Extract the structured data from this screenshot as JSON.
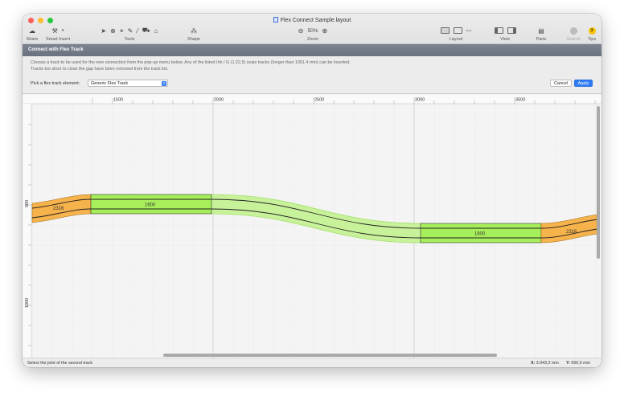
{
  "window": {
    "title": "Flex Connect Sample.layout"
  },
  "toolbar": {
    "share": "Share",
    "smart_insert": "Smart Insert",
    "tools": "Tools",
    "shape": "Shape",
    "zoom_label": "Zoom",
    "zoom_value": "50%",
    "layout": "Layout",
    "view": "View",
    "parts": "Parts",
    "search": "Search",
    "tips": "Tips",
    "tips_glyph": "?"
  },
  "dialog": {
    "title": "Connect with Flex Track",
    "description_line1": "Choose a track to be used for the new connection from the pop-up menu below. Any of the listed IIm / G (1:22,5) scale tracks (longer than 1051.4 mm) can be inserted.",
    "description_line2": "Tracks too short to close the gap have been removed from the track list.",
    "pick_label": "Pick a flex track element:",
    "selected_track": "Generic Flex Track",
    "cancel": "Cancel",
    "apply": "Apply"
  },
  "ruler": {
    "x_ticks": [
      "1500",
      "2000",
      "2500",
      "3000",
      "3500"
    ],
    "y_ticks": [
      "500",
      "1000"
    ]
  },
  "tracks": {
    "left_orange_label": "2316",
    "left_green_label": "1600",
    "right_green_label": "1600",
    "right_orange_label": "2316"
  },
  "colors": {
    "orange": "#f6b24b",
    "green": "#a6ef5a",
    "flex_preview": "#c8f29a",
    "header": "#6f7785",
    "accent": "#2f7bf6"
  },
  "status": {
    "message": "Select the joint of the second track",
    "x_label": "X:",
    "x_value": "3.043,2 mm",
    "y_label": "Y:",
    "y_value": "650,5 mm"
  }
}
